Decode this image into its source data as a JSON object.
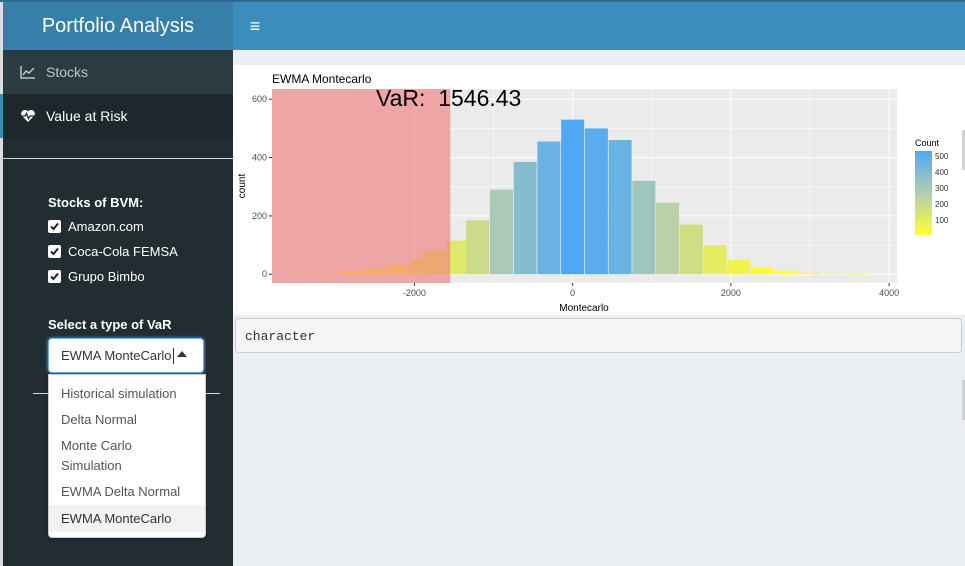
{
  "app": {
    "title": "Portfolio Analysis"
  },
  "sidebar": {
    "items": [
      {
        "label": "Stocks",
        "icon": "line-chart-icon"
      },
      {
        "label": "Value at Risk",
        "icon": "heartbeat-icon"
      }
    ],
    "stocks_label": "Stocks of BVM:",
    "stocks": [
      {
        "label": "Amazon.com",
        "checked": true
      },
      {
        "label": "Coca-Cola FEMSA",
        "checked": true
      },
      {
        "label": "Grupo Bimbo",
        "checked": true
      }
    ],
    "var_label": "Select a type of VaR",
    "select_value": "EWMA MonteCarlo",
    "options": [
      "Historical simulation",
      "Delta Normal",
      "Monte Carlo\nSimulation",
      "EWMA Delta Normal",
      "EWMA MonteCarlo"
    ]
  },
  "chart_data": {
    "type": "bar",
    "title": "EWMA Montecarlo",
    "annotation": "VaR:  1546.43",
    "xlabel": "Montecarlo",
    "ylabel": "count",
    "x_ticks": [
      -2000,
      0,
      2000,
      4000
    ],
    "y_ticks": [
      0,
      200,
      400,
      600
    ],
    "xlim": [
      -3800,
      4100
    ],
    "ylim": [
      -30,
      635
    ],
    "bins": [
      {
        "x": -3400,
        "count": 2
      },
      {
        "x": -3100,
        "count": 5
      },
      {
        "x": -2800,
        "count": 10
      },
      {
        "x": -2500,
        "count": 18
      },
      {
        "x": -2200,
        "count": 30
      },
      {
        "x": -1900,
        "count": 50
      },
      {
        "x": -1750,
        "count": 80
      },
      {
        "x": -1450,
        "count": 115
      },
      {
        "x": -1200,
        "count": 185
      },
      {
        "x": -900,
        "count": 290
      },
      {
        "x": -600,
        "count": 385
      },
      {
        "x": -300,
        "count": 455
      },
      {
        "x": 0,
        "count": 530
      },
      {
        "x": 300,
        "count": 500
      },
      {
        "x": 600,
        "count": 460
      },
      {
        "x": 900,
        "count": 320
      },
      {
        "x": 1200,
        "count": 245
      },
      {
        "x": 1500,
        "count": 170
      },
      {
        "x": 1800,
        "count": 100
      },
      {
        "x": 2100,
        "count": 50
      },
      {
        "x": 2400,
        "count": 25
      },
      {
        "x": 2700,
        "count": 12
      },
      {
        "x": 3000,
        "count": 5
      },
      {
        "x": 3300,
        "count": 2
      },
      {
        "x": 3600,
        "count": 1
      }
    ],
    "var_region": [
      -3800,
      -1546.43
    ],
    "legend": {
      "title": "Count",
      "labels": [
        "500",
        "400",
        "300",
        "200",
        "100"
      ],
      "position": "right"
    },
    "colors": {
      "low": "#ffff33",
      "mid": "#b4ccb0",
      "high": "#4ea8f6",
      "var_fill": "#f08080",
      "panel": "#ebebeb"
    }
  },
  "output": {
    "text": "character"
  }
}
